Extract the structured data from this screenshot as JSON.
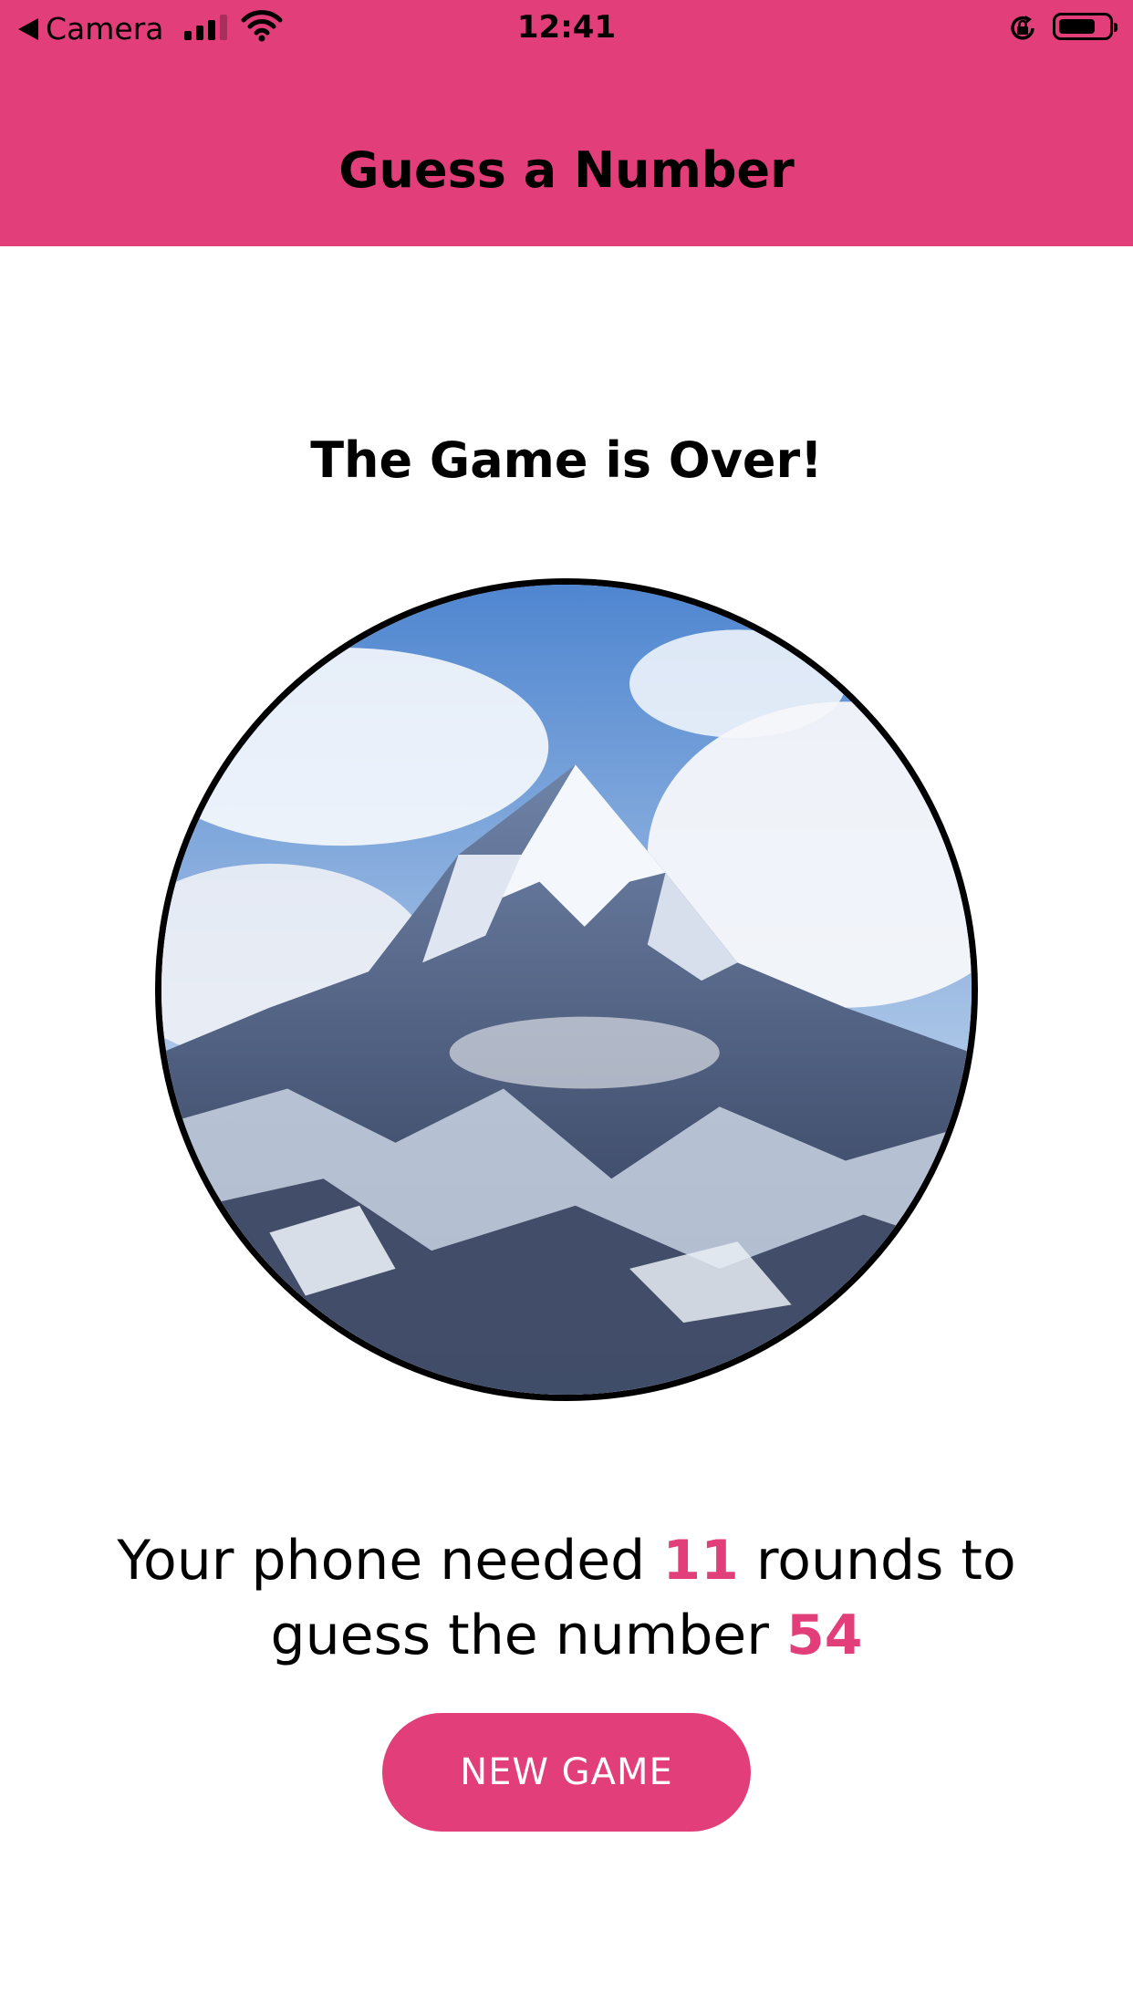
{
  "status_bar": {
    "back_label": "Camera",
    "time": "12:41",
    "battery_level": 0.75
  },
  "header": {
    "title": "Guess a Number",
    "color": "#e13e7a"
  },
  "main": {
    "heading": "The Game is Over!",
    "result": {
      "part1": "Your phone needed ",
      "rounds": "11",
      "part2": " rounds to guess the number ",
      "number": "54"
    },
    "new_game_label": "NEW GAME"
  }
}
